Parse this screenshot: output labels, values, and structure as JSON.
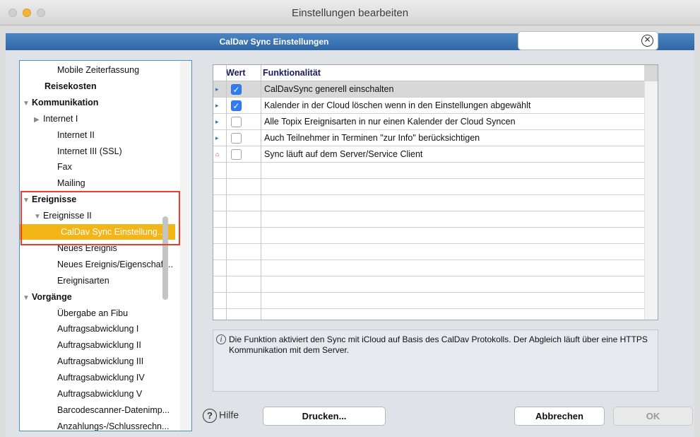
{
  "window": {
    "title": "Einstellungen bearbeiten"
  },
  "header": {
    "title": "CalDav Sync Einstellungen"
  },
  "search": {
    "value": "",
    "placeholder": ""
  },
  "tree": {
    "items": [
      {
        "label": "Mobile Zeiterfassung",
        "level": 2,
        "bold": false
      },
      {
        "label": "Reisekosten",
        "level": 1,
        "bold": true
      },
      {
        "label": "Kommunikation",
        "level": 0,
        "bold": true,
        "expander": "▼"
      },
      {
        "label": "Internet I",
        "level": 1,
        "bold": false,
        "expander": "▶"
      },
      {
        "label": "Internet II",
        "level": 2,
        "bold": false
      },
      {
        "label": "Internet III (SSL)",
        "level": 2,
        "bold": false
      },
      {
        "label": "Fax",
        "level": 2,
        "bold": false
      },
      {
        "label": "Mailing",
        "level": 2,
        "bold": false
      },
      {
        "label": "Ereignisse",
        "level": 0,
        "bold": true,
        "expander": "▼"
      },
      {
        "label": "Ereignisse II",
        "level": 1,
        "bold": false,
        "expander": "▼"
      },
      {
        "label": "CalDav Sync Einstellung...",
        "level": 3,
        "bold": false,
        "selected": true
      },
      {
        "label": "Neues Ereignis",
        "level": 2,
        "bold": false
      },
      {
        "label": "Neues Ereignis/Eigenschaft...",
        "level": 2,
        "bold": false
      },
      {
        "label": "Ereignisarten",
        "level": 2,
        "bold": false
      },
      {
        "label": "Vorgänge",
        "level": 0,
        "bold": true,
        "expander": "▼"
      },
      {
        "label": "Übergabe an Fibu",
        "level": 2,
        "bold": false
      },
      {
        "label": "Auftragsabwicklung I",
        "level": 2,
        "bold": false
      },
      {
        "label": "Auftragsabwicklung II",
        "level": 2,
        "bold": false
      },
      {
        "label": "Auftragsabwicklung III",
        "level": 2,
        "bold": false
      },
      {
        "label": "Auftragsabwicklung IV",
        "level": 2,
        "bold": false
      },
      {
        "label": "Auftragsabwicklung V",
        "level": 2,
        "bold": false
      },
      {
        "label": "Barcodescanner-Datenimp...",
        "level": 2,
        "bold": false
      },
      {
        "label": "Anzahlungs-/Schlussrechn...",
        "level": 2,
        "bold": false
      }
    ]
  },
  "grid": {
    "columns": {
      "wert": "Wert",
      "funktion": "Funktionalität"
    },
    "rows": [
      {
        "icon": "user-icon",
        "checked": true,
        "text": "CalDavSync generell einschalten",
        "selected": true
      },
      {
        "icon": "user-icon",
        "checked": true,
        "text": "Kalender in der Cloud löschen wenn in den Einstellungen abgewählt"
      },
      {
        "icon": "user-icon",
        "checked": false,
        "text": "Alle Topix Ereignisarten in nur einen Kalender der Cloud Syncen"
      },
      {
        "icon": "user-icon",
        "checked": false,
        "text": "Auch Teilnehmer in Terminen \"zur Info\" berücksichtigen"
      },
      {
        "icon": "home-icon",
        "checked": false,
        "text": "Sync läuft auf dem Server/Service Client"
      }
    ],
    "empty_rows": 9
  },
  "info": {
    "text": "Die Funktion aktiviert den Sync mit iCloud auf Basis des CalDav Protokolls. Der Abgleich läuft über eine HTTPS Kommunikation mit dem Server."
  },
  "footer": {
    "help": "Hilfe",
    "print": "Drucken...",
    "cancel": "Abbrechen",
    "ok": "OK"
  },
  "colors": {
    "accent": "#2f66a6",
    "selection": "#f2b619",
    "highlight": "#f23b2f"
  }
}
